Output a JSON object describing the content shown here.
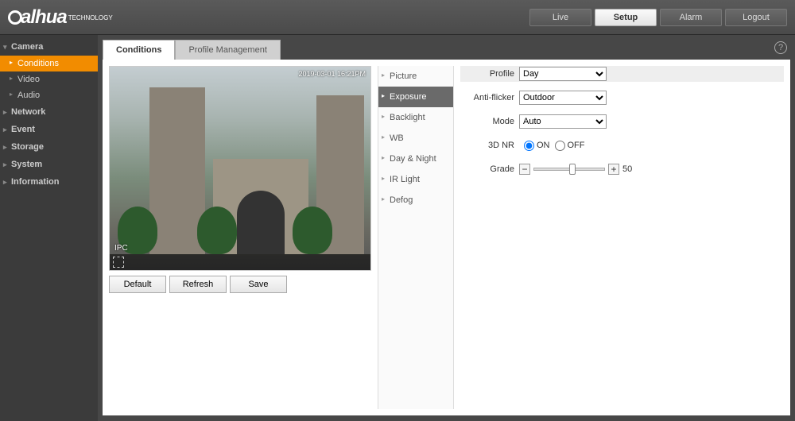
{
  "brand": {
    "name": "alhua",
    "tagline": "TECHNOLOGY"
  },
  "topnav": {
    "live": "Live",
    "setup": "Setup",
    "alarm": "Alarm",
    "logout": "Logout"
  },
  "sidebar": {
    "camera": "Camera",
    "items": [
      "Conditions",
      "Video",
      "Audio"
    ],
    "groups": [
      "Network",
      "Event",
      "Storage",
      "System",
      "Information"
    ]
  },
  "tabs": {
    "conditions": "Conditions",
    "profile_mgmt": "Profile Management"
  },
  "preview": {
    "timestamp": "2019-03-01 16:21PM",
    "label": "IPC"
  },
  "buttons": {
    "default": "Default",
    "refresh": "Refresh",
    "save": "Save"
  },
  "menu": [
    "Picture",
    "Exposure",
    "Backlight",
    "WB",
    "Day & Night",
    "IR Light",
    "Defog"
  ],
  "settings": {
    "profile_label": "Profile",
    "profile_value": "Day",
    "antiflicker_label": "Anti-flicker",
    "antiflicker_value": "Outdoor",
    "mode_label": "Mode",
    "mode_value": "Auto",
    "nr_label": "3D NR",
    "on": "ON",
    "off": "OFF",
    "grade_label": "Grade",
    "grade_value": "50"
  }
}
